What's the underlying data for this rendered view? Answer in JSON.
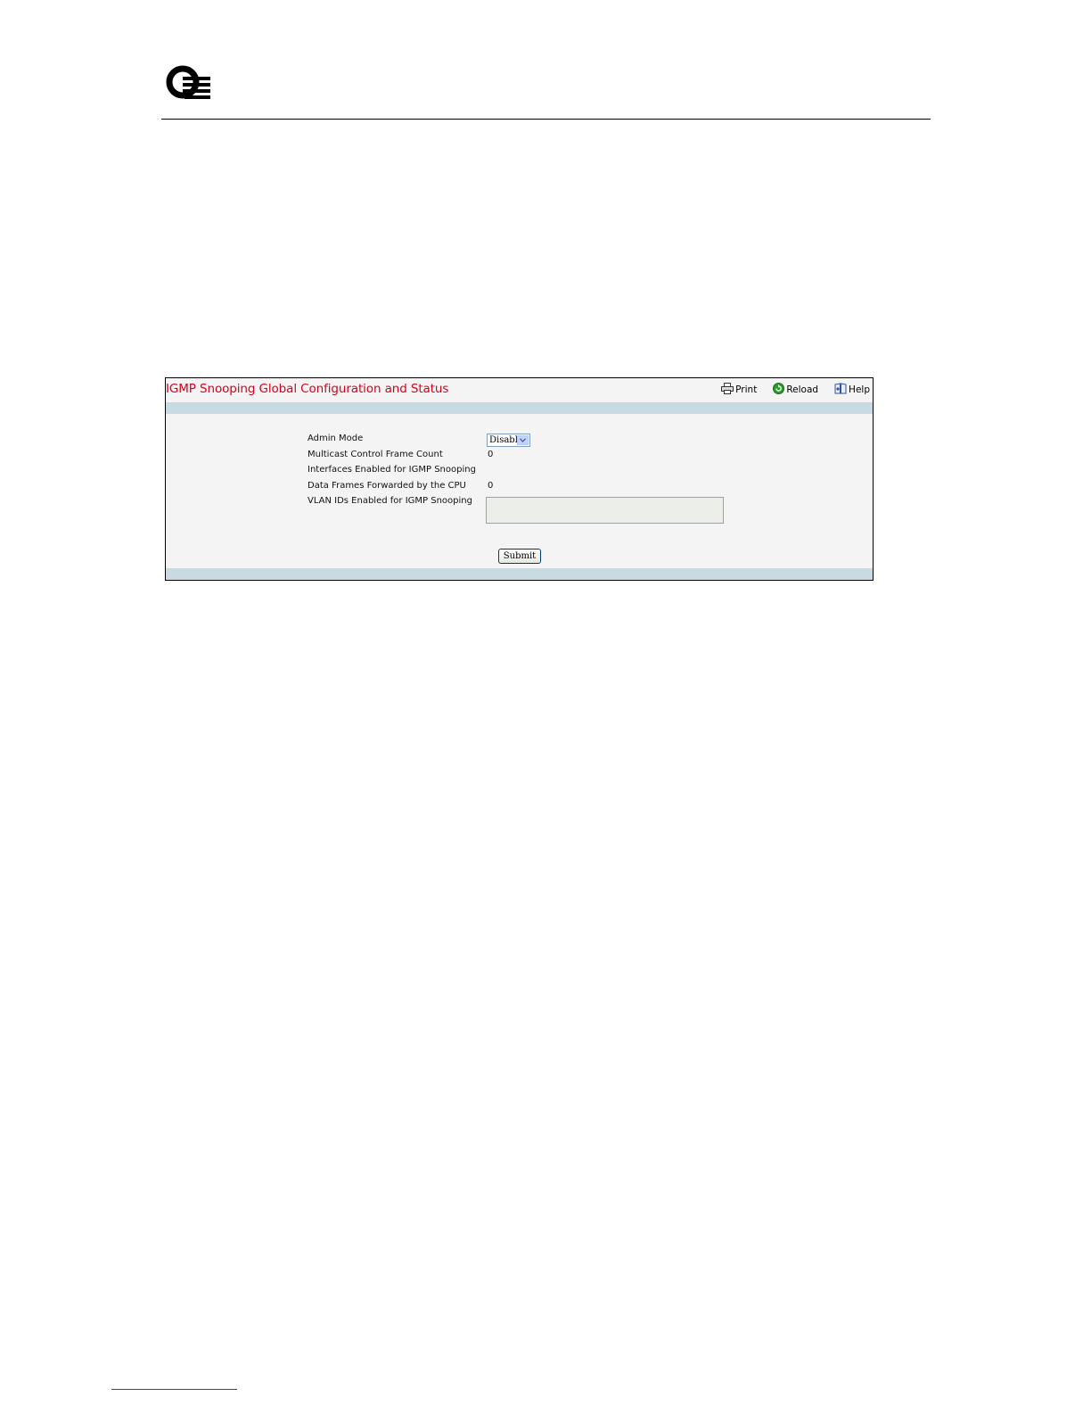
{
  "panel": {
    "title": "IGMP Snooping Global Configuration and Status",
    "toolbar": {
      "print_label": "Print",
      "reload_label": "Reload",
      "help_label": "Help"
    }
  },
  "form": {
    "admin_mode": {
      "label": "Admin Mode",
      "selected": "Disable"
    },
    "multicast_control_frame_count": {
      "label": "Multicast Control Frame Count",
      "value": "0"
    },
    "interfaces_enabled": {
      "label": "Interfaces Enabled for IGMP Snooping",
      "value": ""
    },
    "data_frames_forwarded": {
      "label": "Data Frames Forwarded by the CPU",
      "value": "0"
    },
    "vlan_ids_enabled": {
      "label": "VLAN IDs Enabled for IGMP Snooping",
      "value": ""
    },
    "submit_label": "Submit"
  },
  "colors": {
    "title_red": "#d8001c",
    "band_blue": "#c8dbe2",
    "panel_bg": "#f4f4f4"
  },
  "icons": [
    "company-logo",
    "printer-icon",
    "reload-icon",
    "help-book-icon",
    "chevron-down-icon"
  ]
}
